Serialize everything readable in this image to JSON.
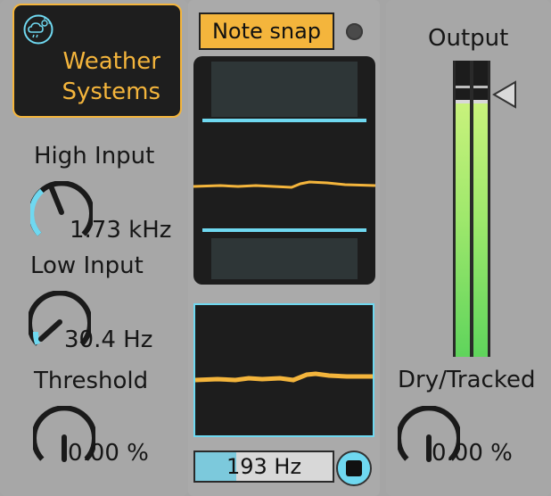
{
  "device": {
    "title_line1": "Weather",
    "title_line2": "Systems",
    "logo_icon": "weather-cloud-icon",
    "accent_color": "#f4b53c",
    "highlight_color": "#6fd8f0"
  },
  "controls": {
    "high_input": {
      "label": "High Input",
      "value": "1.73 kHz",
      "level": 0.62
    },
    "low_input": {
      "label": "Low Input",
      "value": "30.4 Hz",
      "level": 0.18
    },
    "threshold": {
      "label": "Threshold",
      "value": "0.00 %",
      "level": 0.0
    },
    "note_snap": {
      "label": "Note snap",
      "enabled": true
    },
    "frequency": {
      "value": "193 Hz",
      "level": 0.3
    },
    "output": {
      "label": "Output"
    },
    "dry_tracked": {
      "label": "Dry/Tracked",
      "value": "0.00 %",
      "level": 0.0
    }
  }
}
